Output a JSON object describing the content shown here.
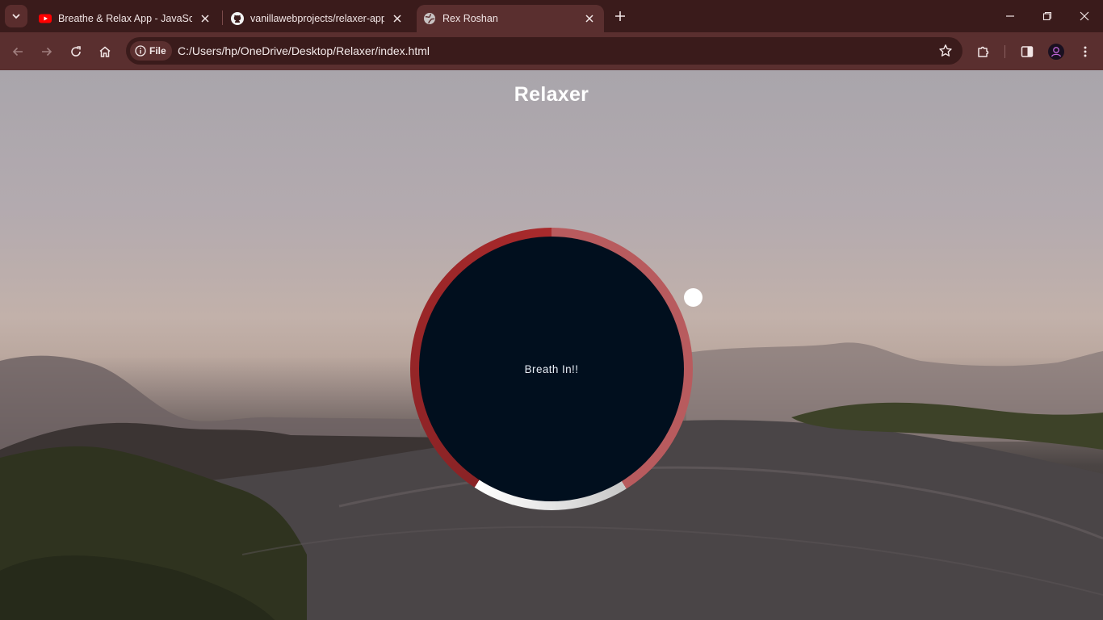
{
  "browser": {
    "tabs": [
      {
        "title": "Breathe & Relax App - JavaScrip",
        "favicon": "youtube-icon",
        "active": false
      },
      {
        "title": "vanillawebprojects/relaxer-app/",
        "favicon": "github-icon",
        "active": false
      },
      {
        "title": "Rex Roshan",
        "favicon": "globe-icon",
        "active": true
      }
    ],
    "site_chip": "File",
    "url": "C:/Users/hp/OneDrive/Desktop/Relaxer/index.html"
  },
  "page": {
    "title": "Relaxer",
    "breath_text": "Breath In!!"
  },
  "colors": {
    "ring_dark": "#9b2628",
    "ring_light": "#b85b5e",
    "circle_bg": "#010f1e",
    "pointer": "#ffffff"
  }
}
